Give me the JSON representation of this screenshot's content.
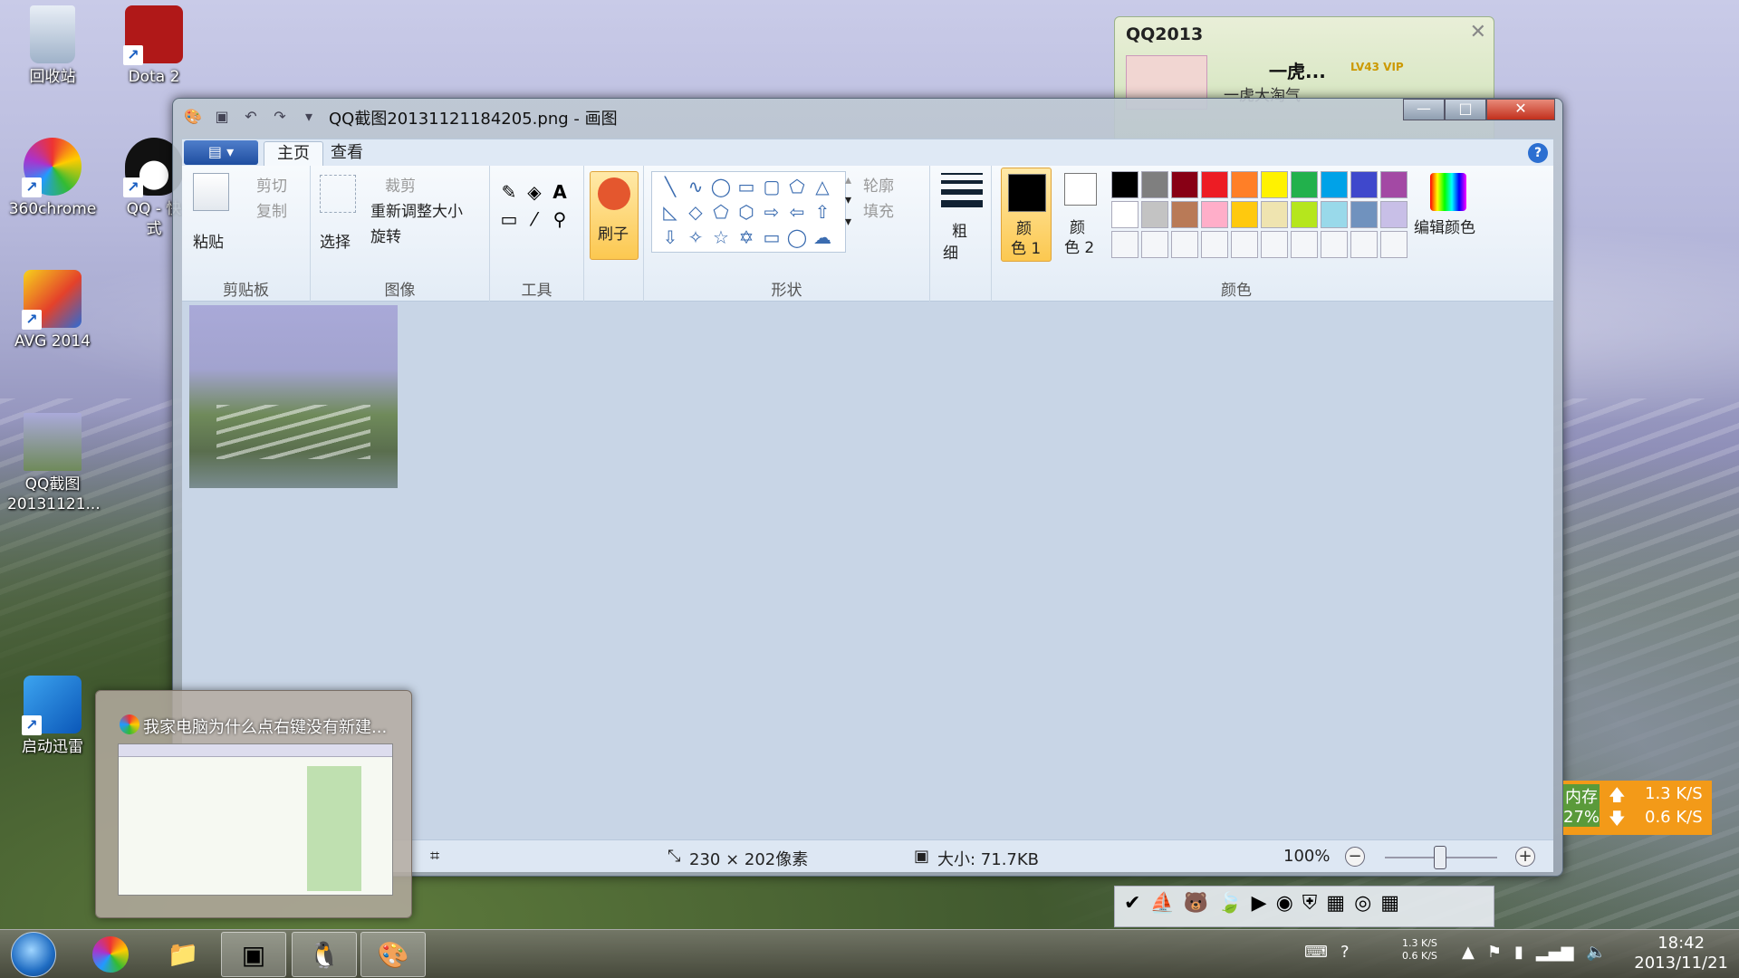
{
  "desktop": {
    "icons": [
      {
        "label": "回收站",
        "icon": "recycle-bin-icon"
      },
      {
        "label": "Dota 2",
        "icon": "dota2-icon"
      },
      {
        "label": "360chrome",
        "icon": "360chrome-icon"
      },
      {
        "label": "QQ - 快",
        "label2": "式",
        "icon": "qq-icon"
      },
      {
        "label": "AVG 2014",
        "icon": "avg-icon"
      },
      {
        "label": "QQ截图",
        "label2": "20131121...",
        "icon": "image-file-icon"
      },
      {
        "label": "启动迅雷",
        "icon": "xunlei-icon"
      }
    ]
  },
  "qq_panel": {
    "title": "QQ2013",
    "nickname": "一虎...",
    "signature": "一虎大淘气",
    "level": "LV43 VIP"
  },
  "paint": {
    "title": "QQ截图20131121184205.png - 画图",
    "tabs": [
      "主页",
      "查看"
    ],
    "groups": {
      "clipboard": {
        "label": "剪贴板",
        "paste": "粘贴",
        "cut": "剪切",
        "copy": "复制"
      },
      "image": {
        "label": "图像",
        "select": "选择",
        "crop": "裁剪",
        "resize": "重新调整大小",
        "rotate": "旋转"
      },
      "tools": {
        "label": "工具"
      },
      "brush": {
        "label": "刷子"
      },
      "shapes": {
        "label": "形状",
        "outline": "轮廓",
        "fill": "填充"
      },
      "size": {
        "label1": "粗",
        "label2": "细"
      },
      "colors": {
        "label": "颜色",
        "color1_a": "颜",
        "color1_b": "色 1",
        "color2_a": "颜",
        "color2_b": "色 2",
        "edit": "编辑颜色",
        "color1": "#000000",
        "color2": "#ffffff",
        "palette_row1": [
          "#000000",
          "#7f7f7f",
          "#880015",
          "#ed1c24",
          "#ff7f27",
          "#fff200",
          "#22b14c",
          "#00a2e8",
          "#3f48cc",
          "#a349a4"
        ],
        "palette_row2": [
          "#ffffff",
          "#c3c3c3",
          "#b97a57",
          "#ffaec9",
          "#ffc90e",
          "#efe4b0",
          "#b5e61d",
          "#99d9ea",
          "#7092be",
          "#c8bfe7"
        ]
      }
    },
    "status": {
      "dimensions": "230 × 202像素",
      "size": "大小: 71.7KB",
      "zoom": "100%",
      "zoom_level": 1.0
    }
  },
  "preview": {
    "title": "我家电脑为什么点右键没有新建..."
  },
  "speed_widget": {
    "mem_label": "内存",
    "mem_value": "27%",
    "up": "1.3 K/S",
    "down": "0.6 K/S"
  },
  "taskbar": {
    "net_up": "1.3 K/S",
    "net_down": "0.6 K/S",
    "time": "18:42",
    "date": "2013/11/21"
  }
}
